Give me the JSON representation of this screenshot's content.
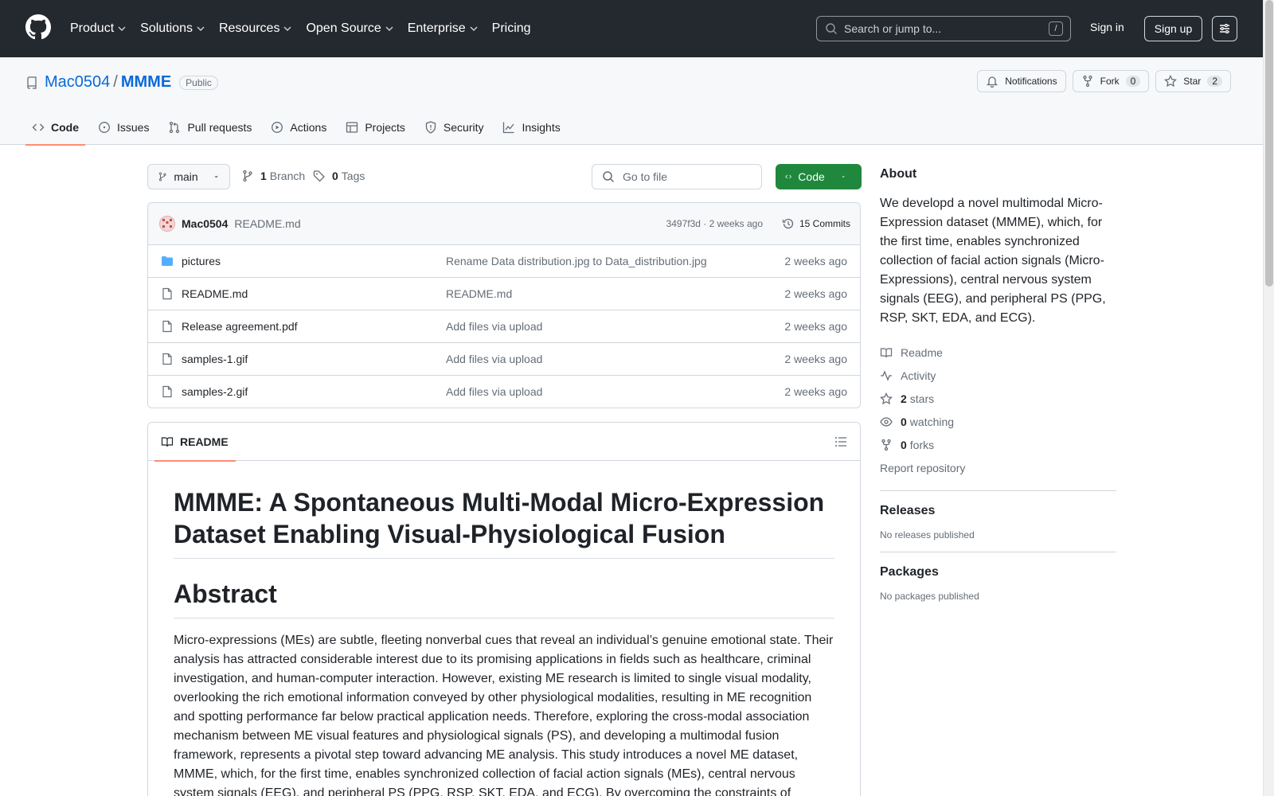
{
  "header": {
    "nav": [
      "Product",
      "Solutions",
      "Resources",
      "Open Source",
      "Enterprise",
      "Pricing"
    ],
    "search_placeholder": "Search or jump to...",
    "search_shortcut": "/",
    "signin": "Sign in",
    "signup": "Sign up"
  },
  "repo": {
    "owner": "Mac0504",
    "separator": "/",
    "name": "MMME",
    "visibility": "Public",
    "notifications": "Notifications",
    "fork_label": "Fork",
    "fork_count": "0",
    "star_label": "Star",
    "star_count": "2"
  },
  "tabs": [
    "Code",
    "Issues",
    "Pull requests",
    "Actions",
    "Projects",
    "Security",
    "Insights"
  ],
  "branch": {
    "name": "main",
    "branches_count": "1",
    "branches_label": "Branch",
    "tags_count": "0",
    "tags_label": "Tags",
    "goto_placeholder": "Go to file",
    "code_label": "Code"
  },
  "commit": {
    "user": "Mac0504",
    "message": "README.md",
    "meta": "3497f3d · 2 weeks ago",
    "count": "15 Commits"
  },
  "files": [
    {
      "type": "folder",
      "name": "pictures",
      "message": "Rename Data distribution.jpg to Data_distribution.jpg",
      "date": "2 weeks ago"
    },
    {
      "type": "file",
      "name": "README.md",
      "message": "README.md",
      "date": "2 weeks ago"
    },
    {
      "type": "file",
      "name": "Release agreement.pdf",
      "message": "Add files via upload",
      "date": "2 weeks ago"
    },
    {
      "type": "file",
      "name": "samples-1.gif",
      "message": "Add files via upload",
      "date": "2 weeks ago"
    },
    {
      "type": "file",
      "name": "samples-2.gif",
      "message": "Add files via upload",
      "date": "2 weeks ago"
    }
  ],
  "readme": {
    "tab": "README",
    "title": "MMME: A Spontaneous Multi-Modal Micro-Expression Dataset Enabling Visual-Physiological Fusion",
    "abstract_heading": "Abstract",
    "abstract_text": "Micro-expressions (MEs) are subtle, fleeting nonverbal cues that reveal an individual’s genuine emotional state. Their analysis has attracted considerable interest due to its promising applications in fields such as healthcare, criminal investigation, and human-computer interaction. However, existing ME research is limited to single visual modality, overlooking the rich emotional information conveyed by other physiological modalities, resulting in ME recognition and spotting performance far below practical application needs. Therefore, exploring the cross-modal association mechanism between ME visual features and physiological signals (PS), and developing a multimodal fusion framework, represents a pivotal step toward advancing ME analysis. This study introduces a novel ME dataset, MMME, which, for the first time, enables synchronized collection of facial action signals (MEs), central nervous system signals (EEG), and peripheral PS (PPG, RSP, SKT, EDA, and ECG). By overcoming the constraints of"
  },
  "about": {
    "heading": "About",
    "description": "We developd a novel multimodal Micro-Expression dataset (MMME), which, for the first time, enables synchronized collection of facial action signals (Micro-Expressions), central nervous system signals (EEG), and peripheral PS (PPG, RSP, SKT, EDA, and ECG).",
    "readme": "Readme",
    "activity": "Activity",
    "stars_count": "2",
    "stars_label": "stars",
    "watching_count": "0",
    "watching_label": "watching",
    "forks_count": "0",
    "forks_label": "forks",
    "report": "Report repository",
    "releases_heading": "Releases",
    "releases_text": "No releases published",
    "packages_heading": "Packages",
    "packages_text": "No packages published"
  }
}
